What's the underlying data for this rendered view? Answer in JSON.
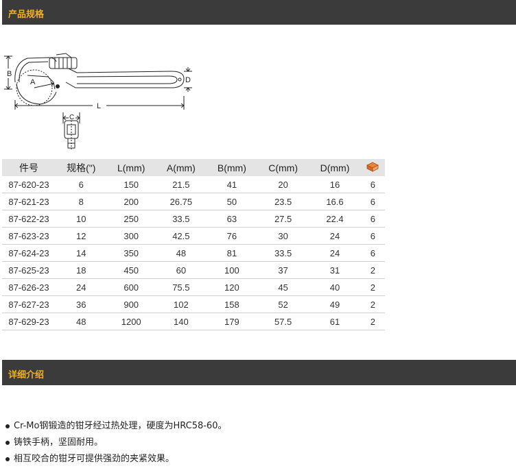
{
  "sections": {
    "specs_title": "产品规格",
    "details_title": "详细介绍"
  },
  "diagram": {
    "label_b": "B",
    "label_a": "A",
    "label_d": "D",
    "label_l": "L",
    "label_c": "C"
  },
  "table": {
    "headers": [
      "件号",
      "规格(\")",
      "L(mm)",
      "A(mm)",
      "B(mm)",
      "C(mm)",
      "D(mm)"
    ],
    "package_icon": "package-box-icon",
    "rows": [
      [
        "87-620-23",
        "6",
        "150",
        "21.5",
        "41",
        "20",
        "16",
        "6"
      ],
      [
        "87-621-23",
        "8",
        "200",
        "26.75",
        "50",
        "23.5",
        "16.6",
        "6"
      ],
      [
        "87-622-23",
        "10",
        "250",
        "33.5",
        "63",
        "27.5",
        "22.4",
        "6"
      ],
      [
        "87-623-23",
        "12",
        "300",
        "42.5",
        "76",
        "30",
        "24",
        "6"
      ],
      [
        "87-624-23",
        "14",
        "350",
        "48",
        "81",
        "33.5",
        "24",
        "6"
      ],
      [
        "87-625-23",
        "18",
        "450",
        "60",
        "100",
        "37",
        "31",
        "2"
      ],
      [
        "87-626-23",
        "24",
        "600",
        "75.5",
        "120",
        "45",
        "40",
        "2"
      ],
      [
        "87-627-23",
        "36",
        "900",
        "102",
        "158",
        "52",
        "49",
        "2"
      ],
      [
        "87-629-23",
        "48",
        "1200",
        "140",
        "179",
        "57.5",
        "61",
        "2"
      ]
    ]
  },
  "details": [
    "Cr-Mo钢锻造的钳牙经过热处理，硬度为HRC58-60。",
    "铸铁手柄，坚固耐用。",
    "相互咬合的钳牙可提供强劲的夹紧效果。"
  ],
  "colors": {
    "header_bar": "#3b3b3b",
    "header_text": "#f2b01e",
    "table_header_bg": "#e4e4e4"
  }
}
